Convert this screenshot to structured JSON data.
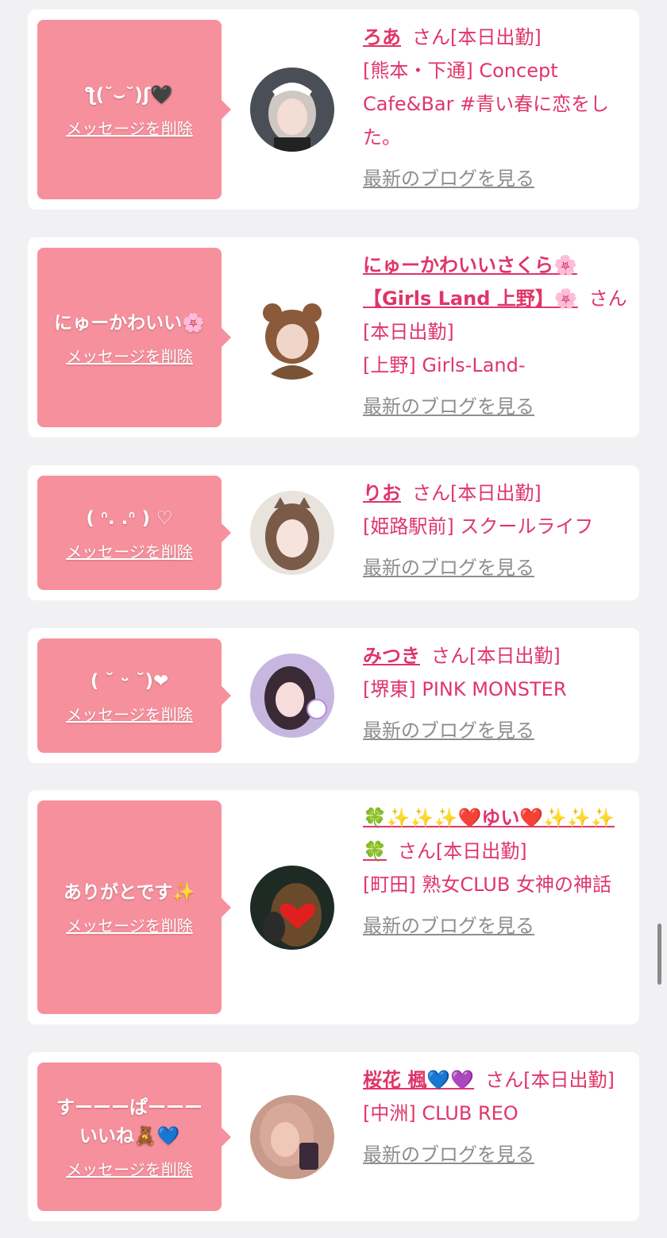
{
  "delete_label": "メッセージを削除",
  "blog_label": "最新のブログを見る",
  "san_label": "さん[本日出勤]",
  "items": [
    {
      "message": "ƪ(˘⌣˘)ʃ🖤",
      "name": "ろあ",
      "shop": "[熊本・下通] Concept Cafe&Bar #青い春に恋をした。",
      "avatar": "maid-headdress-girl"
    },
    {
      "message": "にゅーかわいい🌸",
      "name": "にゅーかわいいさくら🌸【Girls Land 上野】🌸",
      "shop": "[上野] Girls-Land-",
      "avatar": "bear-hood-girl"
    },
    {
      "message": "( ᐢ. .ᐢ ) ♡",
      "name": "りお",
      "shop": "[姫路駅前] スクールライフ",
      "avatar": "girl-with-cat-ears"
    },
    {
      "message": "( ˘ ᵕ ˘)❤",
      "name": "みつき",
      "shop": "[堺東] PINK MONSTER",
      "avatar": "girl-with-bunny-sticker"
    },
    {
      "message": "ありがとです✨",
      "name": "🍀✨✨✨❤️ゆい❤️✨✨✨🍀",
      "shop": "[町田] 熟女CLUB 女神の神話",
      "avatar": "heart-covered-face"
    },
    {
      "message": "すーーーぱーーー\nいいね🧸💙",
      "name": "桜花 楓💙💜",
      "shop": "[中洲] CLUB REO",
      "avatar": "host-with-figure"
    }
  ],
  "colors": {
    "bubble": "#f7909d",
    "accent": "#e0356a",
    "card": "#ffffff",
    "background": "#f1f1f3",
    "link_gray": "#8e8e8e"
  }
}
